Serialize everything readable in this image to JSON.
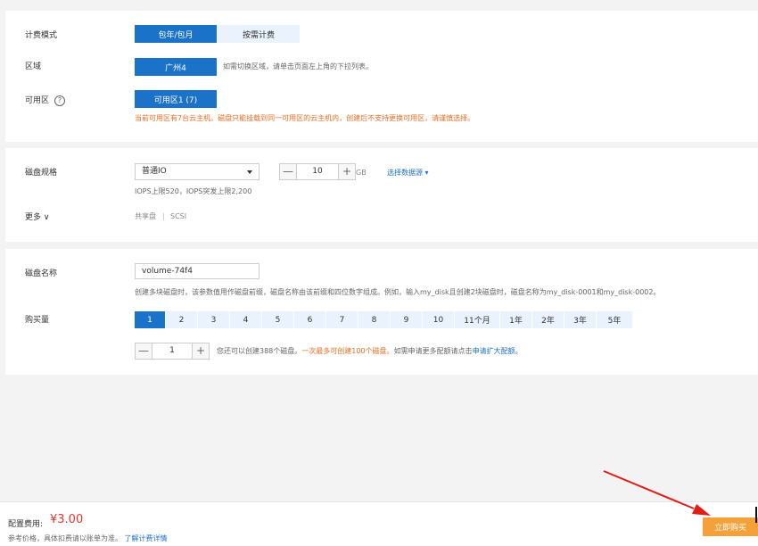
{
  "billing": {
    "label": "计费模式",
    "options": [
      "包年/包月",
      "按需计费"
    ],
    "selected": "包年/包月"
  },
  "region": {
    "label": "区域",
    "value": "广州4",
    "hint": "如需切换区域，请单击页面左上角的下拉列表。"
  },
  "az": {
    "label": "可用区",
    "help_icon": "?",
    "value": "可用区1 (7)",
    "warning": "当前可用区有7台云主机。磁盘只能挂载到同一可用区的云主机内，创建后不支持更换可用区，请谨慎选择。"
  },
  "disk_spec": {
    "label": "磁盘规格",
    "type_value": "普通IO",
    "size_value": "10",
    "size_unit": "GB",
    "size_minus": "—",
    "size_plus": "+",
    "datasource_link": "选择数据源 ▾",
    "iops_hint": "IOPS上限520，IOPS突发上限2,200",
    "more_label": "更多 ∨",
    "shared": "共享盘",
    "separator": "|",
    "scsi": "SCSI"
  },
  "disk_name": {
    "label": "磁盘名称",
    "value": "volume-74f4",
    "hint": "创建多块磁盘时，该参数值用作磁盘前缀，磁盘名称由该前缀和四位数字组成。例如，输入my_disk且创建2块磁盘时，磁盘名称为my_disk-0001和my_disk-0002。"
  },
  "purchase": {
    "label": "购买量",
    "durations": [
      "1",
      "2",
      "3",
      "4",
      "5",
      "6",
      "7",
      "8",
      "9",
      "10",
      "11个月",
      "1年",
      "2年",
      "3年",
      "5年"
    ],
    "selected_duration": "1",
    "count_value": "1",
    "count_minus": "—",
    "count_plus": "+",
    "count_hint_1": "您还可以创建388个磁盘。",
    "count_hint_2": "一次最多可创建100个磁盘。",
    "count_hint_3": "如需申请更多配额请点击",
    "count_hint_link": "申请扩大配额",
    "count_hint_end": "。"
  },
  "footer": {
    "price_label": "配置费用:",
    "price": "¥3.00",
    "note": "参考价格，具体扣费请以账单为准。",
    "note_link": "了解计费详情",
    "buy_button": "立即购买"
  },
  "colors": {
    "primary": "#1a72c9",
    "light": "#eaf3fd",
    "warning": "#ef6c24",
    "price": "#e5362a",
    "buy": "#f4a13a",
    "annotation_arrow": "#e21d16"
  }
}
